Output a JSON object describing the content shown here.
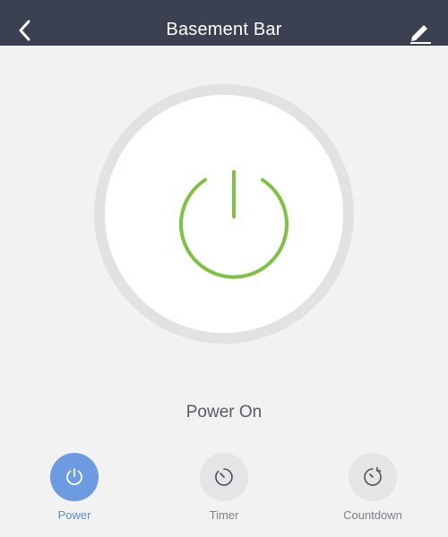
{
  "header": {
    "title": "Basement Bar",
    "back_icon": "chevron-left-icon",
    "edit_icon": "pencil-icon"
  },
  "device": {
    "power_state": "on",
    "power_icon": "power-icon",
    "power_color": "#7dc241",
    "status_text": "Power On"
  },
  "actions": [
    {
      "label": "Power",
      "icon": "power-icon",
      "active": true
    },
    {
      "label": "Timer",
      "icon": "clock-icon",
      "active": false
    },
    {
      "label": "Countdown",
      "icon": "countdown-icon",
      "active": false
    }
  ],
  "colors": {
    "header_bg": "#3b4150",
    "active_accent": "#6d9be1",
    "page_bg": "#f2f2f2"
  }
}
